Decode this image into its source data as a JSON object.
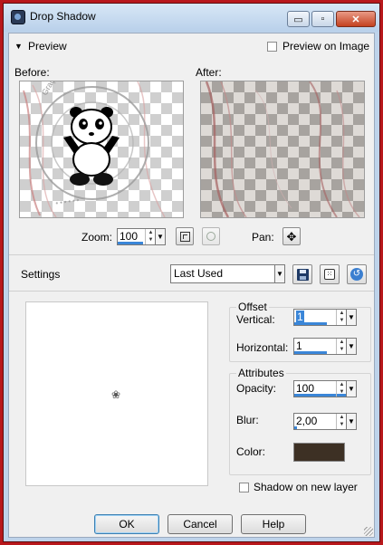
{
  "window": {
    "title": "Drop Shadow",
    "controls": {
      "minimize": "▭",
      "maximize": "▫",
      "close": "✕"
    }
  },
  "preview": {
    "toggle_label": "Preview",
    "preview_on_image_label": "Preview on Image",
    "preview_on_image_checked": false,
    "before_label": "Before:",
    "after_label": "After:",
    "watermark_text": "Graça Saraiva Art's PSP",
    "zoom_label": "Zoom:",
    "zoom_value": "100",
    "pan_label": "Pan:"
  },
  "settings": {
    "label": "Settings",
    "preset_value": "Last Used"
  },
  "offset": {
    "title": "Offset",
    "vertical_label": "Vertical:",
    "vertical_value": "1",
    "horizontal_label": "Horizontal:",
    "horizontal_value": "1"
  },
  "attributes": {
    "title": "Attributes",
    "opacity_label": "Opacity:",
    "opacity_value": "100",
    "blur_label": "Blur:",
    "blur_value": "2,00",
    "color_label": "Color:",
    "color_hex": "#3d3024"
  },
  "shadow_new_layer_label": "Shadow on new layer",
  "shadow_new_layer_checked": false,
  "buttons": {
    "ok": "OK",
    "cancel": "Cancel",
    "help": "Help"
  },
  "icons": {
    "save": "save-icon",
    "randomize": "dice-icon",
    "reset": "reset-icon",
    "zoom_fit": "zoom-fit-icon",
    "zoom_actual": "zoom-actual-icon",
    "pan": "pan-move-icon"
  }
}
